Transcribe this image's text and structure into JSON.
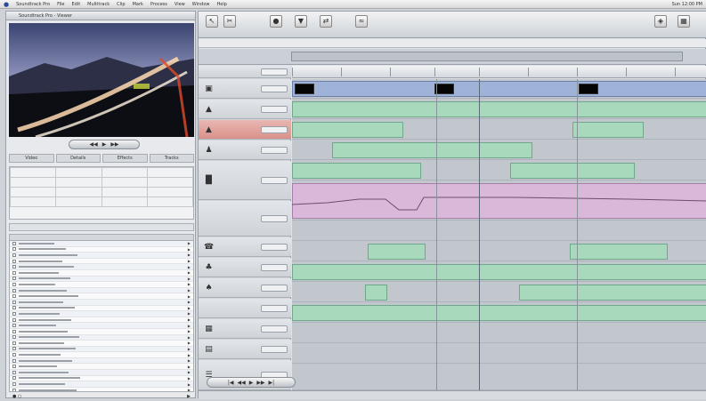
{
  "menubar": {
    "items": [
      "Soundtrack Pro",
      "File",
      "Edit",
      "Multitrack",
      "Clip",
      "Mark",
      "Process",
      "View",
      "Window",
      "Help"
    ],
    "clock": "Sun 12:00 PM"
  },
  "left_panel": {
    "title": "Soundtrack Pro - Viewer",
    "transport": [
      "◀◀",
      "▶",
      "▶▶"
    ],
    "inspector_tabs": [
      "Video",
      "Details",
      "Effects",
      "Tracks"
    ],
    "clip_count": 28
  },
  "main": {
    "tracks": 12
  }
}
